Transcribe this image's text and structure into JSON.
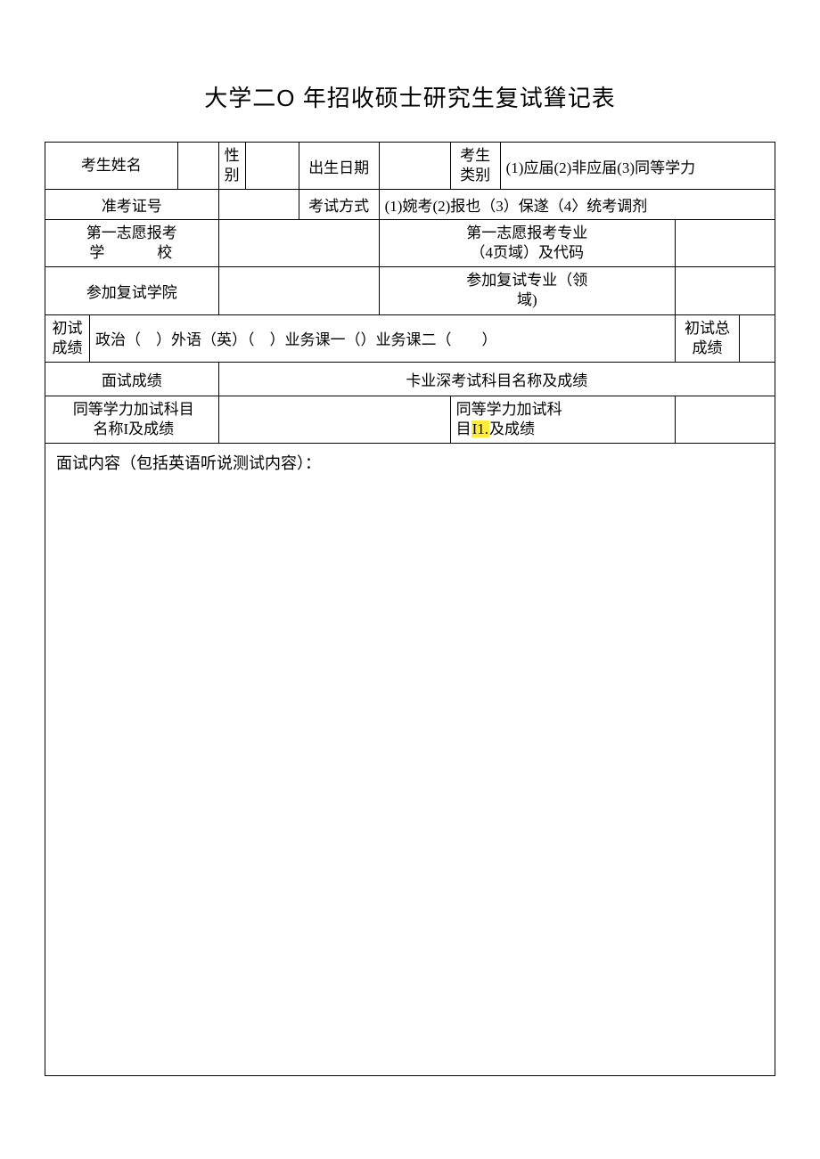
{
  "title": "大学二O   年招收硕士研究生复试聳记表",
  "row1": {
    "name_label": "考生姓名",
    "gender_label": "性别",
    "dob_label": "出生日期",
    "category_label": "考生类别",
    "category_options": "(1)应届(2)非应届(3)同等学力"
  },
  "row2": {
    "ticket_label": "准考证号",
    "exam_mode_label": "考试方式",
    "exam_mode_options": "(1)婉考(2)报也（3）保遂（4〉统考调剂"
  },
  "row3": {
    "first_school_label_line1": "第一志愿报考",
    "first_school_label_line2": "学　　　校",
    "first_major_label_line1": "第一志愿报考专业",
    "first_major_label_line2": "（4页域）及代码"
  },
  "row4": {
    "retest_college_label": "参加复试学院",
    "retest_major_label_line1": "参加复试专业（领",
    "retest_major_label_line2": "域)"
  },
  "row5": {
    "prelim_label": "初试成绩",
    "prelim_content": "政治（　）外语（英）（　）业务课一（）业务课二（　　）",
    "prelim_total_label": "初试总成绩"
  },
  "row6": {
    "interview_score_label": "面试成绩",
    "prof_exam_label": "卡业深考试科目名称及成绩"
  },
  "row7": {
    "equiv_subject1_label_line1": "同等学力加试科目",
    "equiv_subject1_label_line2_pre": "名称",
    "equiv_subject1_label_line2_mark": "I",
    "equiv_subject1_label_line2_post": "及成绩",
    "equiv_subject2_label_line1": "同等学力加试科",
    "equiv_subject2_label_line2_pre": "目",
    "equiv_subject2_label_line2_mark": "I1.",
    "equiv_subject2_label_line2_post": "及成绩"
  },
  "interview_content_label": "面试内容（包括英语听说测试内容）："
}
